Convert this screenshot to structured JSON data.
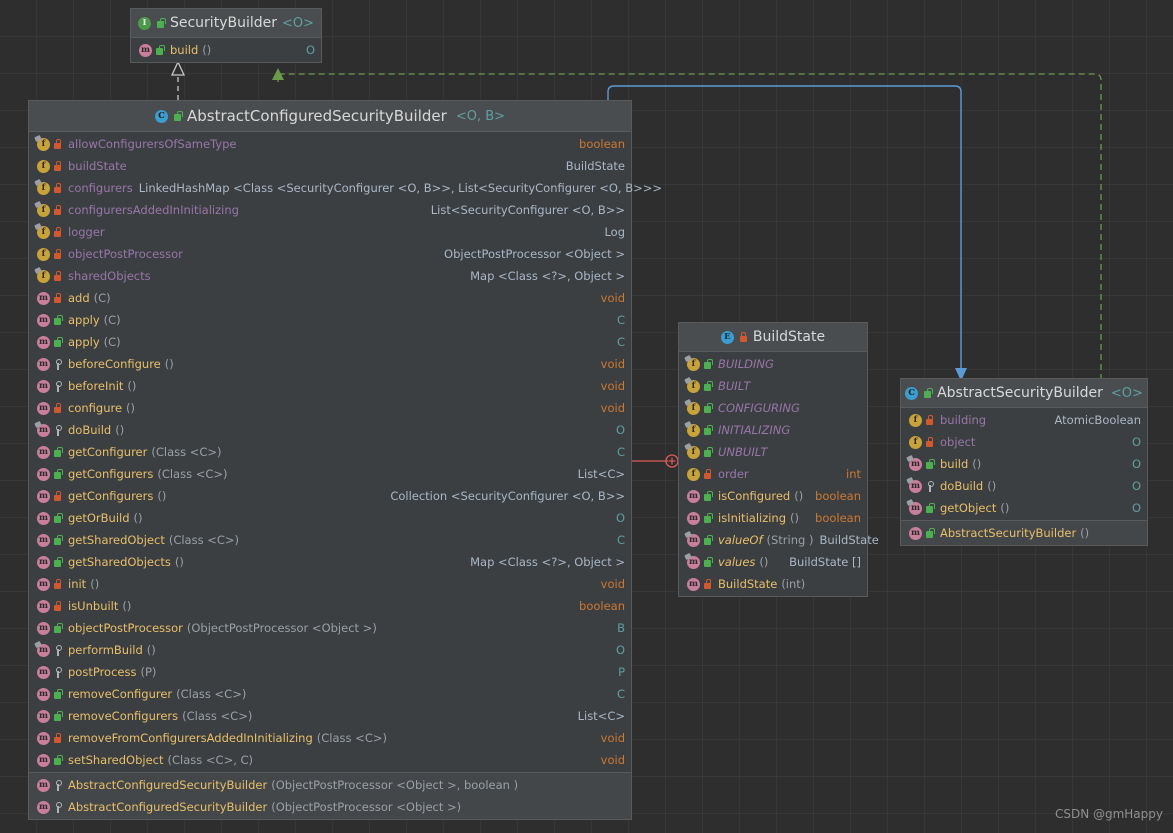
{
  "watermark": "CSDN @gmHappy",
  "nodes": {
    "securityBuilder": {
      "title": "SecurityBuilder",
      "generics": "<O>",
      "kind_icon": "interface-icon",
      "members": [
        {
          "icon": "method-icon",
          "vis": "public",
          "name": "build",
          "params": "()",
          "ret": "O",
          "ret_class": "c-gen",
          "static": false,
          "italic": false
        }
      ]
    },
    "abstractConfiguredSecurityBuilder": {
      "title": "AbstractConfiguredSecurityBuilder",
      "generics": "<O, B>",
      "kind_icon": "class-icon",
      "members": [
        {
          "icon": "field-icon",
          "vis": "protected",
          "name": "allowConfigurersOfSameType",
          "params": "",
          "ret": "boolean",
          "ret_class": "c-kw",
          "static": true,
          "italic": false
        },
        {
          "icon": "field-icon",
          "vis": "protected",
          "name": "buildState",
          "params": "",
          "ret": "BuildState",
          "ret_class": "c-type",
          "static": false,
          "italic": false
        },
        {
          "icon": "field-icon",
          "vis": "protected",
          "name": "configurers",
          "params": "",
          "ret": "LinkedHashMap <Class <SecurityConfigurer <O, B>>, List<SecurityConfigurer <O, B>>>",
          "ret_class": "c-type",
          "static": true,
          "italic": false
        },
        {
          "icon": "field-icon",
          "vis": "protected",
          "name": "configurersAddedInInitializing",
          "params": "",
          "ret": "List<SecurityConfigurer <O, B>>",
          "ret_class": "c-type",
          "static": true,
          "italic": false
        },
        {
          "icon": "field-icon",
          "vis": "protected",
          "name": "logger",
          "params": "",
          "ret": "Log",
          "ret_class": "c-type",
          "static": true,
          "italic": false
        },
        {
          "icon": "field-icon",
          "vis": "protected",
          "name": "objectPostProcessor",
          "params": "",
          "ret": "ObjectPostProcessor <Object >",
          "ret_class": "c-type",
          "static": false,
          "italic": false
        },
        {
          "icon": "field-icon",
          "vis": "protected",
          "name": "sharedObjects",
          "params": "",
          "ret": "Map <Class <?>, Object >",
          "ret_class": "c-type",
          "static": true,
          "italic": false
        },
        {
          "icon": "method-icon",
          "vis": "protected",
          "name": "add",
          "params": "(C)",
          "ret": "void",
          "ret_class": "c-kw",
          "static": false,
          "italic": false
        },
        {
          "icon": "method-icon",
          "vis": "public",
          "name": "apply",
          "params": "(C)",
          "ret": "C",
          "ret_class": "c-gen",
          "static": false,
          "italic": false
        },
        {
          "icon": "method-icon",
          "vis": "public",
          "name": "apply",
          "params": "(C)",
          "ret": "C",
          "ret_class": "c-gen",
          "static": false,
          "italic": false
        },
        {
          "icon": "method-icon",
          "vis": "private",
          "name": "beforeConfigure",
          "params": "()",
          "ret": "void",
          "ret_class": "c-kw",
          "static": false,
          "italic": false
        },
        {
          "icon": "method-icon",
          "vis": "private",
          "name": "beforeInit",
          "params": "()",
          "ret": "void",
          "ret_class": "c-kw",
          "static": false,
          "italic": false
        },
        {
          "icon": "method-icon",
          "vis": "protected",
          "name": "configure",
          "params": "()",
          "ret": "void",
          "ret_class": "c-kw",
          "static": false,
          "italic": false
        },
        {
          "icon": "method-icon",
          "vis": "private",
          "name": "doBuild",
          "params": "()",
          "ret": "O",
          "ret_class": "c-gen",
          "static": true,
          "italic": false
        },
        {
          "icon": "method-icon",
          "vis": "public",
          "name": "getConfigurer",
          "params": "(Class <C>)",
          "ret": "C",
          "ret_class": "c-gen",
          "static": false,
          "italic": false
        },
        {
          "icon": "method-icon",
          "vis": "public",
          "name": "getConfigurers",
          "params": "(Class <C>)",
          "ret": "List<C>",
          "ret_class": "c-type",
          "static": false,
          "italic": false
        },
        {
          "icon": "method-icon",
          "vis": "protected",
          "name": "getConfigurers",
          "params": "()",
          "ret": "Collection <SecurityConfigurer <O, B>>",
          "ret_class": "c-type",
          "static": false,
          "italic": false
        },
        {
          "icon": "method-icon",
          "vis": "public",
          "name": "getOrBuild",
          "params": "()",
          "ret": "O",
          "ret_class": "c-gen",
          "static": false,
          "italic": false
        },
        {
          "icon": "method-icon",
          "vis": "public",
          "name": "getSharedObject",
          "params": "(Class <C>)",
          "ret": "C",
          "ret_class": "c-gen",
          "static": false,
          "italic": false
        },
        {
          "icon": "method-icon",
          "vis": "public",
          "name": "getSharedObjects",
          "params": "()",
          "ret": "Map <Class <?>, Object >",
          "ret_class": "c-type",
          "static": false,
          "italic": false
        },
        {
          "icon": "method-icon",
          "vis": "protected",
          "name": "init",
          "params": "()",
          "ret": "void",
          "ret_class": "c-kw",
          "static": false,
          "italic": false
        },
        {
          "icon": "method-icon",
          "vis": "protected",
          "name": "isUnbuilt",
          "params": "()",
          "ret": "boolean",
          "ret_class": "c-kw",
          "static": false,
          "italic": false
        },
        {
          "icon": "method-icon",
          "vis": "public",
          "name": "objectPostProcessor",
          "params": "(ObjectPostProcessor <Object >)",
          "ret": "B",
          "ret_class": "c-gen",
          "static": false,
          "italic": false
        },
        {
          "icon": "method-icon",
          "vis": "private",
          "name": "performBuild",
          "params": "()",
          "ret": "O",
          "ret_class": "c-gen",
          "static": true,
          "italic": false
        },
        {
          "icon": "method-icon",
          "vis": "private",
          "name": "postProcess",
          "params": "(P)",
          "ret": "P",
          "ret_class": "c-gen",
          "static": false,
          "italic": false
        },
        {
          "icon": "method-icon",
          "vis": "public",
          "name": "removeConfigurer",
          "params": "(Class <C>)",
          "ret": "C",
          "ret_class": "c-gen",
          "static": false,
          "italic": false
        },
        {
          "icon": "method-icon",
          "vis": "public",
          "name": "removeConfigurers",
          "params": "(Class <C>)",
          "ret": "List<C>",
          "ret_class": "c-type",
          "static": false,
          "italic": false
        },
        {
          "icon": "method-icon",
          "vis": "protected",
          "name": "removeFromConfigurersAddedInInitializing",
          "params": "(Class <C>)",
          "ret": "void",
          "ret_class": "c-kw",
          "static": false,
          "italic": false
        },
        {
          "icon": "method-icon",
          "vis": "public",
          "name": "setSharedObject",
          "params": "(Class <C>, C)",
          "ret": "void",
          "ret_class": "c-kw",
          "static": false,
          "italic": false
        }
      ],
      "constructors": [
        {
          "icon": "method-icon",
          "vis": "private",
          "name": "AbstractConfiguredSecurityBuilder",
          "params": "(ObjectPostProcessor <Object >, boolean )",
          "ret": "",
          "ret_class": "c-type",
          "static": false,
          "italic": false
        },
        {
          "icon": "method-icon",
          "vis": "private",
          "name": "AbstractConfiguredSecurityBuilder",
          "params": "(ObjectPostProcessor <Object >)",
          "ret": "",
          "ret_class": "c-type",
          "static": false,
          "italic": false
        }
      ]
    },
    "buildState": {
      "title": "BuildState",
      "generics": "",
      "kind_icon": "enum-icon",
      "vis": "protected",
      "members": [
        {
          "icon": "field-icon",
          "vis": "public",
          "name": "BUILDING",
          "params": "",
          "ret": "",
          "ret_class": "c-type",
          "static": true,
          "italic": true
        },
        {
          "icon": "field-icon",
          "vis": "public",
          "name": "BUILT",
          "params": "",
          "ret": "",
          "ret_class": "c-type",
          "static": true,
          "italic": true
        },
        {
          "icon": "field-icon",
          "vis": "public",
          "name": "CONFIGURING",
          "params": "",
          "ret": "",
          "ret_class": "c-type",
          "static": true,
          "italic": true
        },
        {
          "icon": "field-icon",
          "vis": "public",
          "name": "INITIALIZING",
          "params": "",
          "ret": "",
          "ret_class": "c-type",
          "static": true,
          "italic": true
        },
        {
          "icon": "field-icon",
          "vis": "public",
          "name": "UNBUILT",
          "params": "",
          "ret": "",
          "ret_class": "c-type",
          "static": true,
          "italic": true
        },
        {
          "icon": "field-icon",
          "vis": "protected",
          "name": "order",
          "params": "",
          "ret": "int",
          "ret_class": "c-kw",
          "static": false,
          "italic": false
        },
        {
          "icon": "method-icon",
          "vis": "public",
          "name": "isConfigured",
          "params": "()",
          "ret": "boolean",
          "ret_class": "c-kw",
          "static": false,
          "italic": false
        },
        {
          "icon": "method-icon",
          "vis": "public",
          "name": "isInitializing",
          "params": "()",
          "ret": "boolean",
          "ret_class": "c-kw",
          "static": false,
          "italic": false
        },
        {
          "icon": "method-icon",
          "vis": "public",
          "name": "valueOf",
          "params": "(String )",
          "ret": "BuildState",
          "ret_class": "c-type",
          "static": true,
          "italic": true
        },
        {
          "icon": "method-icon",
          "vis": "public",
          "name": "values",
          "params": "()",
          "ret": "BuildState []",
          "ret_class": "c-type",
          "static": true,
          "italic": true
        },
        {
          "icon": "method-icon",
          "vis": "protected",
          "name": "BuildState",
          "params": "(int)",
          "ret": "",
          "ret_class": "c-type",
          "static": false,
          "italic": false
        }
      ]
    },
    "abstractSecurityBuilder": {
      "title": "AbstractSecurityBuilder",
      "generics": "<O>",
      "kind_icon": "class-icon",
      "members": [
        {
          "icon": "field-icon",
          "vis": "protected",
          "name": "building",
          "params": "",
          "ret": "AtomicBoolean",
          "ret_class": "c-type",
          "static": false,
          "italic": false
        },
        {
          "icon": "field-icon",
          "vis": "protected",
          "name": "object",
          "params": "",
          "ret": "O",
          "ret_class": "c-gen",
          "static": false,
          "italic": false
        },
        {
          "icon": "method-icon",
          "vis": "public",
          "name": "build",
          "params": "()",
          "ret": "O",
          "ret_class": "c-gen",
          "static": true,
          "italic": false
        },
        {
          "icon": "method-icon",
          "vis": "private",
          "name": "doBuild",
          "params": "()",
          "ret": "O",
          "ret_class": "c-gen",
          "static": true,
          "italic": false
        },
        {
          "icon": "method-icon",
          "vis": "public",
          "name": "getObject",
          "params": "()",
          "ret": "O",
          "ret_class": "c-gen",
          "static": true,
          "italic": false
        }
      ],
      "constructors": [
        {
          "icon": "method-icon",
          "vis": "public",
          "name": "AbstractSecurityBuilder",
          "params": "()",
          "ret": "",
          "ret_class": "c-type",
          "static": false,
          "italic": false
        }
      ]
    }
  },
  "edges": {
    "implements_color": "#c8c8c8",
    "realization_color": "#6a9a4a",
    "association_color": "#5b9bd5",
    "highlight_color": "#e05b5b"
  }
}
